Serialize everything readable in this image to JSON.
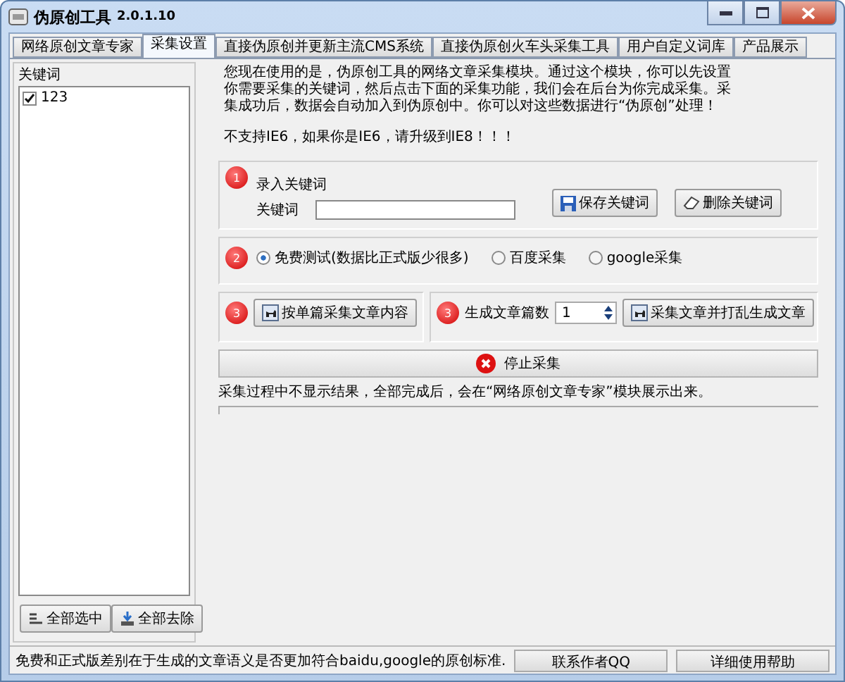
{
  "window": {
    "title": "伪原创工具",
    "version": "2.0.1.10"
  },
  "tabs": [
    {
      "label": "网络原创文章专家",
      "selected": false
    },
    {
      "label": "采集设置",
      "selected": true
    },
    {
      "label": "直接伪原创并更新主流CMS系统",
      "selected": false
    },
    {
      "label": "直接伪原创火车头采集工具",
      "selected": false
    },
    {
      "label": "用户自定义词库",
      "selected": false
    },
    {
      "label": "产品展示",
      "selected": false
    }
  ],
  "sidebar": {
    "title": "关键词",
    "items": [
      {
        "label": "123",
        "checked": true
      }
    ],
    "buttons": [
      "全部选中",
      "全部去除"
    ]
  },
  "intro": "您现在使用的是，伪原创工具的网络文章采集模块。通过这个模块，你可以先设置你需要采集的关键词，然后点击下面的采集功能，我们会在后台为你完成采集。采集成功后，数据会自动加入到伪原创中。你可以对这些数据进行“伪原创”处理！",
  "warning": "不支持IE6，如果你是IE6，请升级到IE8！！！",
  "step1": {
    "badge": "1",
    "heading": "录入关键词",
    "field_label": "关键词",
    "buttons": [
      "保存关键词",
      "删除关键词"
    ]
  },
  "step2": {
    "badge": "2",
    "options": [
      {
        "label": "免费测试(数据比正式版少很多)",
        "selected": true
      },
      {
        "label": "百度采集",
        "selected": false
      },
      {
        "label": "google采集",
        "selected": false
      }
    ]
  },
  "step3": {
    "left": {
      "badge": "3",
      "button": "按单篇采集文章内容"
    },
    "right": {
      "badge": "3",
      "label": "生成文章篇数",
      "value": "1",
      "button": "采集文章并打乱生成文章"
    }
  },
  "stop_button": "停止采集",
  "note": "采集过程中不显示结果，全部完成后，会在“网络原创文章专家”模块展示出来。",
  "status_bar": {
    "message": "免费和正式版差别在于生成的文章语义是否更加符合baidu,google的原创标准.",
    "buttons": [
      "联系作者QQ",
      "详细使用帮助"
    ]
  }
}
